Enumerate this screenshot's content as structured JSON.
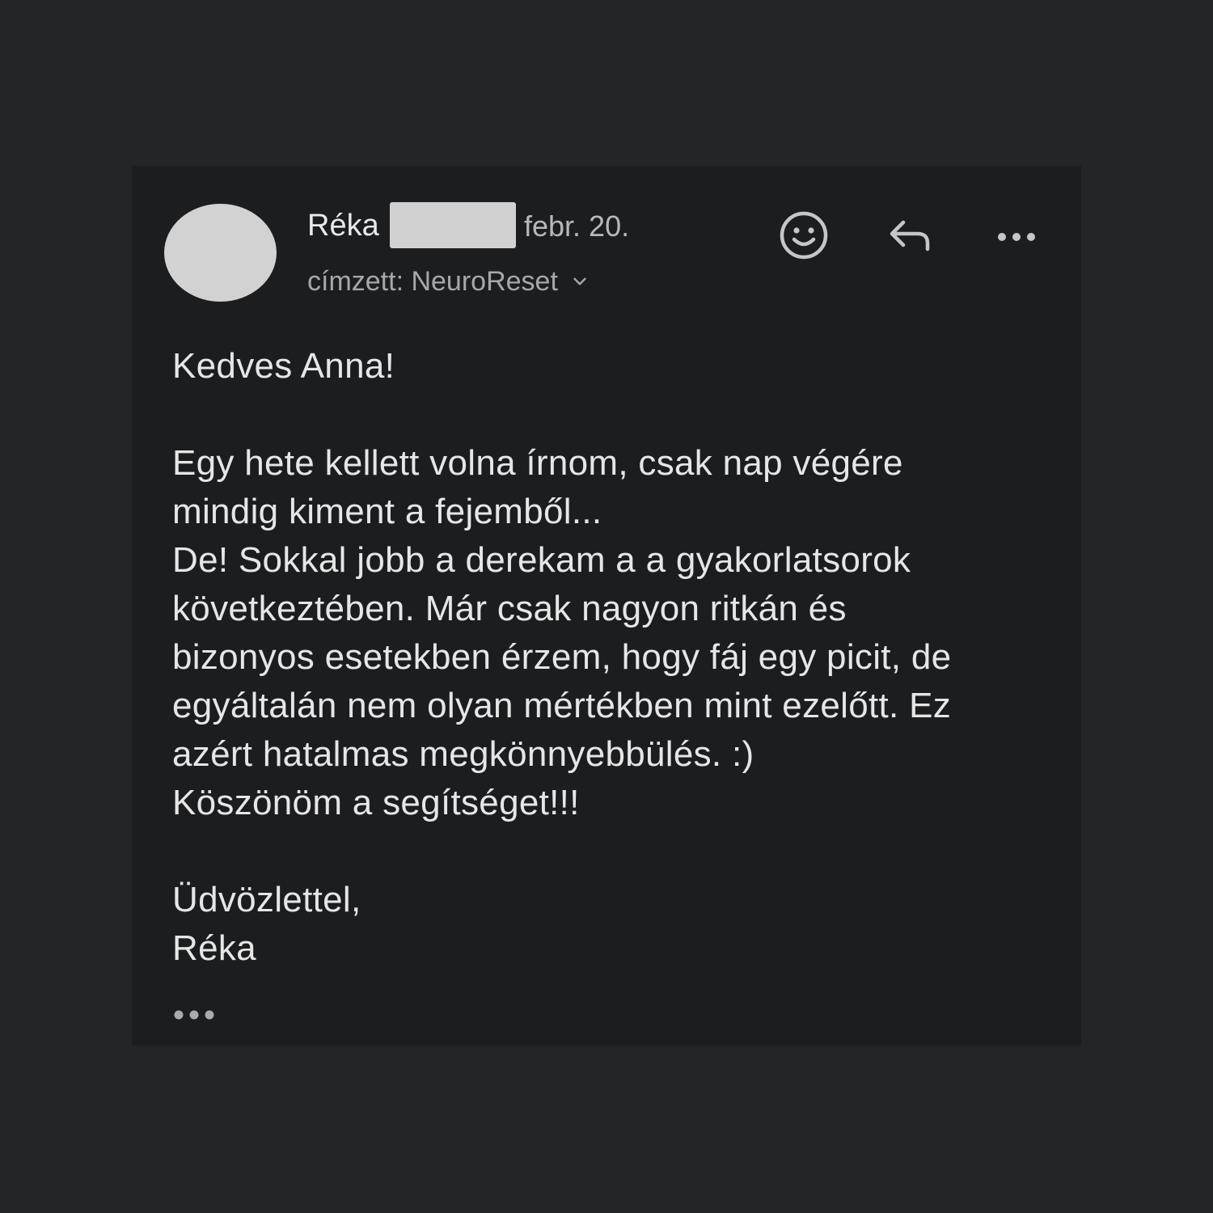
{
  "email": {
    "sender_name": "Réka",
    "date": "febr. 20.",
    "recipient_label": "címzett: NeuroReset",
    "body": {
      "greeting": "Kedves Anna!",
      "paragraph_lines": [
        "Egy hete kellett volna írnom, csak nap végére",
        "mindig kiment a fejemből...",
        "De! Sokkal jobb a derekam a a gyakorlatsorok",
        "következtében. Már csak nagyon ritkán és",
        "bizonyos esetekben érzem, hogy fáj egy picit, de",
        "egyáltalán nem olyan mértékben mint ezelőtt. Ez",
        "azért hatalmas megkönnyebbülés. :)",
        "Köszönöm a segítséget!!!"
      ],
      "closing": "Üdvözlettel,",
      "signature": "Réka"
    }
  },
  "icons": {
    "reaction": "emoji-smile-icon",
    "reply": "reply-icon",
    "more": "more-horizontal-icon",
    "expand": "expand-quoted-icon",
    "chevron": "chevron-down-icon"
  },
  "colors": {
    "page_background": "#232629",
    "card_background": "#1c1d1f",
    "text_primary": "#e6e6e6",
    "text_secondary": "#a6a8ab",
    "icon": "#c4c6c9",
    "redaction": "#d1d1d1"
  }
}
